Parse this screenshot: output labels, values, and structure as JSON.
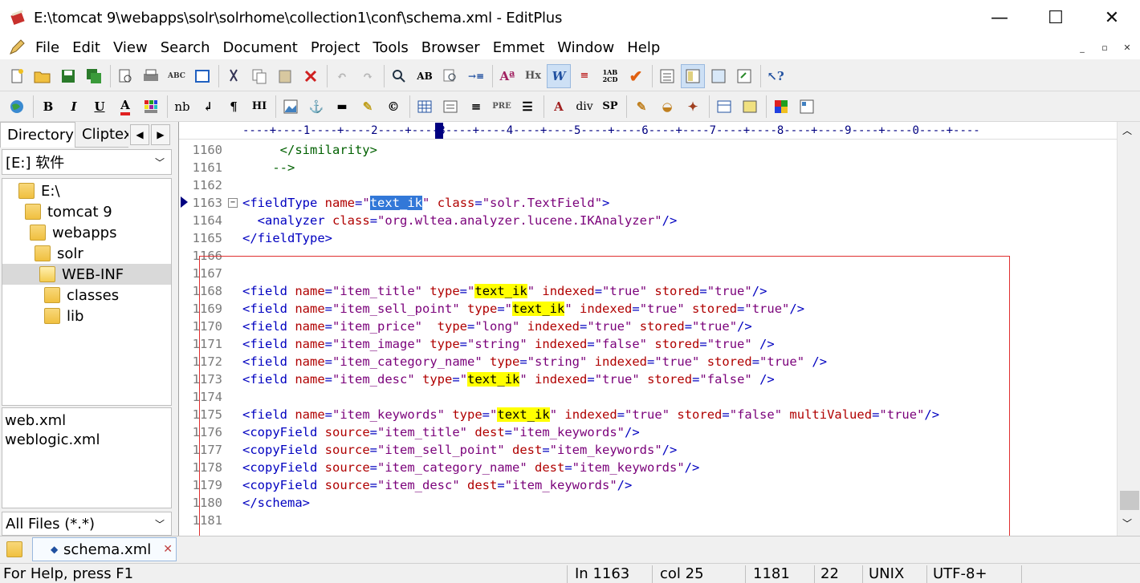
{
  "window": {
    "title": "E:\\tomcat 9\\webapps\\solr\\solrhome\\collection1\\conf\\schema.xml - EditPlus",
    "minimize": "—",
    "maximize": "☐",
    "close": "✕"
  },
  "menu": [
    "File",
    "Edit",
    "View",
    "Search",
    "Document",
    "Project",
    "Tools",
    "Browser",
    "Emmet",
    "Window",
    "Help"
  ],
  "mdi": {
    "min": "_",
    "restore": "▫",
    "close": "✕"
  },
  "toolbar2_text": {
    "nb": "nb",
    "hi": "HI",
    "pre": "PRE",
    "div": "div",
    "sp": "SP",
    "hx": "Hx",
    "abc": "ABC",
    "w": "W"
  },
  "left": {
    "tabs": [
      "Directory",
      "Cliptex"
    ],
    "drive": "[E:] 软件",
    "tree": [
      "E:\\",
      "tomcat 9",
      "webapps",
      "solr",
      "WEB-INF",
      "classes",
      "lib"
    ],
    "files": [
      "web.xml",
      "weblogic.xml"
    ],
    "filter": "All Files (*.*)"
  },
  "ruler": "----+----1----+----2----+----3----+----4----+----5----+----6----+----7----+----8----+----9----+----0----+----",
  "code": [
    {
      "n": "1160",
      "t": "     </similarity>"
    },
    {
      "n": "1161",
      "t": "    -->"
    },
    {
      "n": "1162",
      "t": ""
    },
    {
      "n": "1163",
      "t": "<fieldType name=\"text_ik\" class=\"solr.TextField\">"
    },
    {
      "n": "1164",
      "t": "  <analyzer class=\"org.wltea.analyzer.lucene.IKAnalyzer\"/>"
    },
    {
      "n": "1165",
      "t": "</fieldType>"
    },
    {
      "n": "1166",
      "t": ""
    },
    {
      "n": "1167",
      "t": ""
    },
    {
      "n": "1168",
      "t": "<field name=\"item_title\" type=\"text_ik\" indexed=\"true\" stored=\"true\"/>"
    },
    {
      "n": "1169",
      "t": "<field name=\"item_sell_point\" type=\"text_ik\" indexed=\"true\" stored=\"true\"/>"
    },
    {
      "n": "1170",
      "t": "<field name=\"item_price\"  type=\"long\" indexed=\"true\" stored=\"true\"/>"
    },
    {
      "n": "1171",
      "t": "<field name=\"item_image\" type=\"string\" indexed=\"false\" stored=\"true\" />"
    },
    {
      "n": "1172",
      "t": "<field name=\"item_category_name\" type=\"string\" indexed=\"true\" stored=\"true\" />"
    },
    {
      "n": "1173",
      "t": "<field name=\"item_desc\" type=\"text_ik\" indexed=\"true\" stored=\"false\" />"
    },
    {
      "n": "1174",
      "t": ""
    },
    {
      "n": "1175",
      "t": "<field name=\"item_keywords\" type=\"text_ik\" indexed=\"true\" stored=\"false\" multiValued=\"true\"/>"
    },
    {
      "n": "1176",
      "t": "<copyField source=\"item_title\" dest=\"item_keywords\"/>"
    },
    {
      "n": "1177",
      "t": "<copyField source=\"item_sell_point\" dest=\"item_keywords\"/>"
    },
    {
      "n": "1178",
      "t": "<copyField source=\"item_category_name\" dest=\"item_keywords\"/>"
    },
    {
      "n": "1179",
      "t": "<copyField source=\"item_desc\" dest=\"item_keywords\"/>"
    },
    {
      "n": "1180",
      "t": "</schema>"
    },
    {
      "n": "1181",
      "t": ""
    }
  ],
  "doc_tab": "schema.xml",
  "status": {
    "help": "For Help, press F1",
    "ln": "In 1163",
    "col": "col 25",
    "lines": "1181",
    "num": "22",
    "eol": "UNIX",
    "enc": "UTF-8+"
  },
  "colors": {
    "tag": "#0000c0",
    "attr": "#b00000",
    "value": "#7a007a",
    "comment": "#006000",
    "highlight": "#ffff00",
    "selection": "#3278d8",
    "annotation_box": "#e03030"
  }
}
